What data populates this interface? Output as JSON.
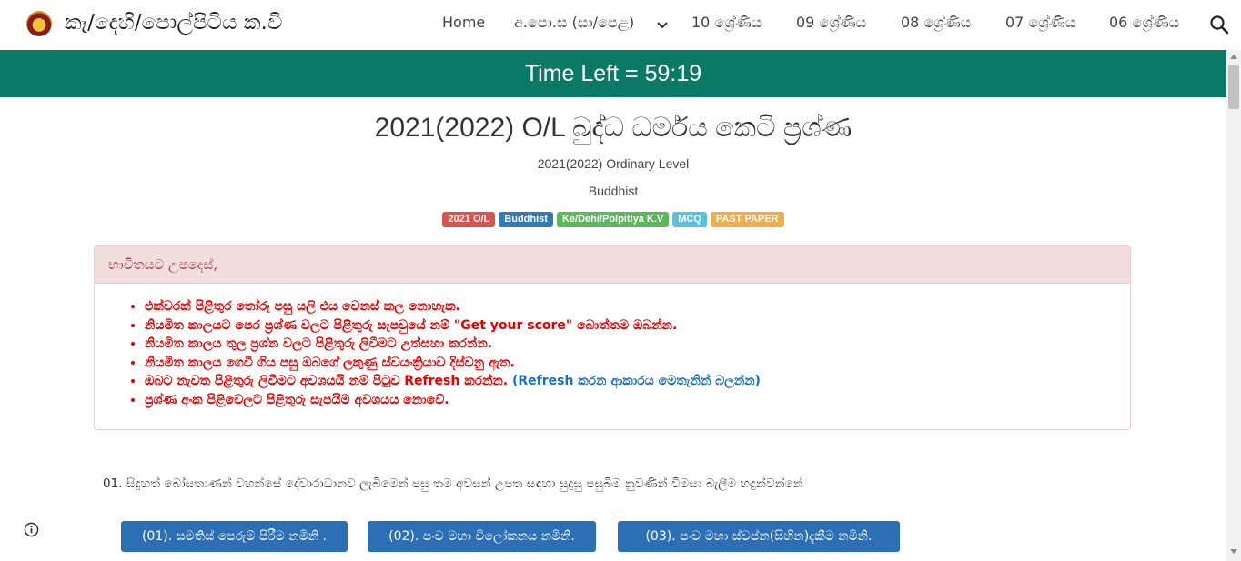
{
  "header": {
    "site_title": "කෑ/දෙහි/පොල්පිටිය ක.වි",
    "nav": [
      "Home",
      "අ.පො.ස (සා/පෙළ)",
      "10 ශ්‍රේණිය",
      "09 ශ්‍රේණිය",
      "08 ශ්‍රේණිය",
      "07 ශ්‍රේණිය",
      "06 ශ්‍රේණිය"
    ],
    "icons": [
      "crest-logo",
      "chevron-down-icon",
      "search-icon"
    ]
  },
  "timer": {
    "text": "Time Left = 59:19",
    "color": "#0a7a66"
  },
  "page": {
    "title": "2021(2022) O/L බුද්ධ ධර්මය කෙටි ප්‍රශ්ණ",
    "subtitle": "2021(2022) Ordinary Level",
    "subject": "Buddhist",
    "labels": [
      {
        "text": "2021 O/L",
        "color": "#d9534f"
      },
      {
        "text": "Buddhist",
        "color": "#337ab7"
      },
      {
        "text": "Ke/Dehi/Polpitiya K.V",
        "color": "#5cb85c"
      },
      {
        "text": "MCQ",
        "color": "#5bc0de"
      },
      {
        "text": "PAST PAPER",
        "color": "#f0ad4e"
      }
    ]
  },
  "instructions": {
    "heading": "භාවිතයට උපදෙස්,",
    "items": [
      "එක්වරක් පිළිතුර තෝරූ පසු යලි එය වෙනස් කල නොහැක.",
      "නියමිත කාලයට පෙර ප්‍රශ්ණ වලට පිළිතුරු සැපවුයේ නම් \"Get your score\" බොත්තම ඔබන්න.",
      "නියමිත කාලය තුල ප්‍රශ්න වලට පිළිතුරු ලිවීමට උත්සහා කරන්න.",
      "නියමිත කාලය ගෙවී ගිය පසු ඔබගේ ලකුණු ස්වයංක්‍රියාව දිස්වනු ඇත.",
      "ඔබට නැවත පිළිතුරු ලිවීමට අවශයයි නම් පිටුව Refresh කරන්න.",
      "ප්‍රශ්ණ අංක පිළිවෙලට පිළිතුරු සැපයීම අවශයය නොවේ."
    ],
    "refresh_link": "(Refresh කරන ආකාරය මෙතැනින් බලන්න)",
    "colors": {
      "heading_bg": "#f2dede",
      "text": "#e60000",
      "link": "#1a6fbb"
    }
  },
  "question": {
    "text": "01. සිදුහත් බෝසතාණන් වහන්සේ දේවාරාධානව ලැබීමෙන් පසු තම අවසන් උපත සඳහා සුදුසු පසුබිම නුවණින් විමසා බැලීම හඳුන්වන්නේ",
    "answers": [
      "(01). සමතිස් පෙරුම් පිරීම නමිනි .",
      "(02). පංච මහා විලෝකනය නමිනි.",
      "(03). පංච මහා ස්වප්න(සිහින)දැකීම නමිනි."
    ],
    "answer_color": "#2d6fb5"
  }
}
